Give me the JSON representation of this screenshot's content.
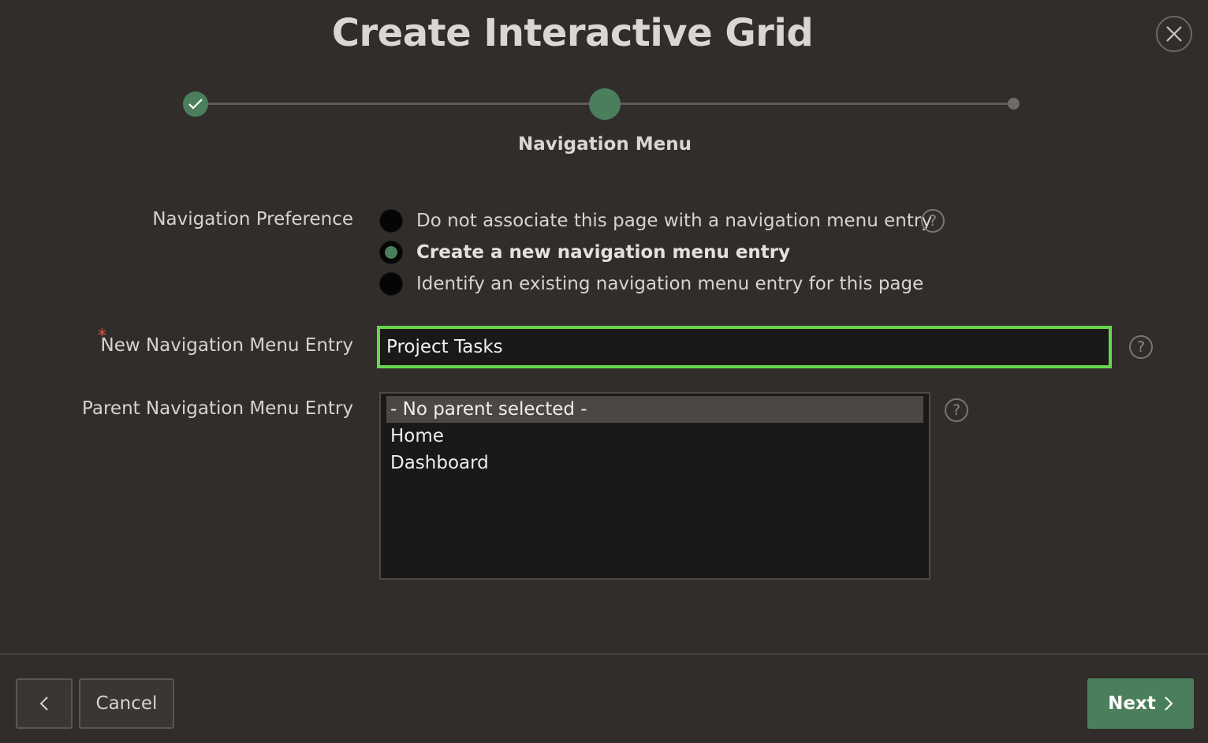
{
  "dialog": {
    "title": "Create Interactive Grid",
    "close_icon": "close-icon"
  },
  "progress": {
    "current_step_label": "Navigation Menu",
    "steps": [
      {
        "state": "completed",
        "icon": "check-icon"
      },
      {
        "state": "current"
      },
      {
        "state": "upcoming"
      }
    ]
  },
  "form": {
    "navigation_preference": {
      "label": "Navigation Preference",
      "options": [
        {
          "label": "Do not associate this page with a navigation menu entry",
          "selected": false
        },
        {
          "label": "Create a new navigation menu entry",
          "selected": true
        },
        {
          "label": "Identify an existing navigation menu entry for this page",
          "selected": false
        }
      ]
    },
    "new_entry": {
      "label": "New Navigation Menu Entry",
      "required_marker": "*",
      "value": "Project Tasks"
    },
    "parent_entry": {
      "label": "Parent Navigation Menu Entry",
      "options": [
        {
          "label": "- No parent selected -",
          "selected": true
        },
        {
          "label": "Home",
          "selected": false
        },
        {
          "label": "Dashboard",
          "selected": false
        }
      ]
    },
    "help_icon_text": "?"
  },
  "footer": {
    "cancel_label": "Cancel",
    "next_label": "Next",
    "back_icon": "chevron-left-icon",
    "next_icon": "chevron-right-icon"
  },
  "colors": {
    "background": "#312d2a",
    "accent_green": "#4b7f5b",
    "focus_border": "#66d64f",
    "required": "#e2574c"
  }
}
